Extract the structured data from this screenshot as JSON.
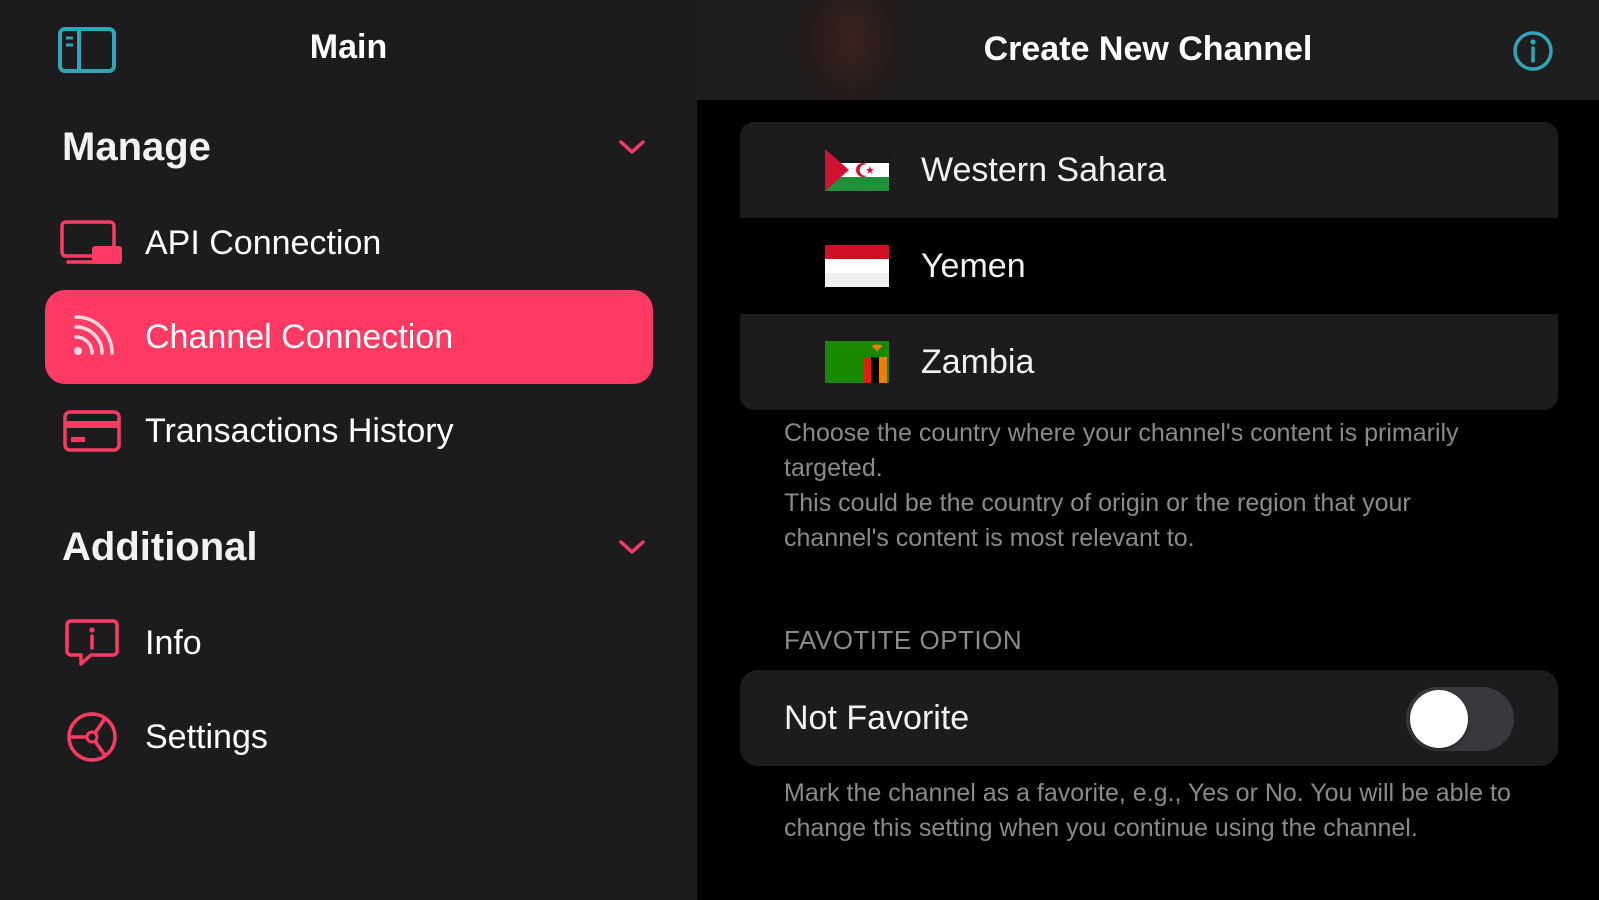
{
  "colors": {
    "accent": "#ff3b63",
    "toggle_icon": "#2fa5b8",
    "sidebar_bg": "#1c1c1e",
    "main_bg": "#000000"
  },
  "sidebar": {
    "title": "Main",
    "toggle_icon": "sidebar-toggle-icon",
    "sections": [
      {
        "title": "Manage",
        "items": [
          {
            "label": "API Connection",
            "icon": "devices-icon",
            "active": false
          },
          {
            "label": "Channel Connection",
            "icon": "rss-feed-icon",
            "active": true
          },
          {
            "label": "Transactions History",
            "icon": "credit-card-icon",
            "active": false
          }
        ]
      },
      {
        "title": "Additional",
        "items": [
          {
            "label": "Info",
            "icon": "info-bubble-icon",
            "active": false
          },
          {
            "label": "Settings",
            "icon": "steering-wheel-icon",
            "active": false
          }
        ]
      }
    ]
  },
  "main": {
    "title": "Create New Channel",
    "info_icon": "info-circle-icon",
    "countries": [
      {
        "name": "Western Sahara",
        "flag": "western-sahara-flag"
      },
      {
        "name": "Yemen",
        "flag": "yemen-flag"
      },
      {
        "name": "Zambia",
        "flag": "zambia-flag"
      }
    ],
    "country_helper": [
      "Choose the country where your channel's content is primarily targeted.",
      "This could be the country of origin or the region that your channel's content is most relevant to."
    ],
    "favorite_section_caption": "FAVOTITE OPTION",
    "favorite_label": "Not Favorite",
    "favorite_on": false,
    "favorite_helper": "Mark the channel as a favorite, e.g., Yes or No. You will be able to change this setting when you continue using the channel."
  }
}
